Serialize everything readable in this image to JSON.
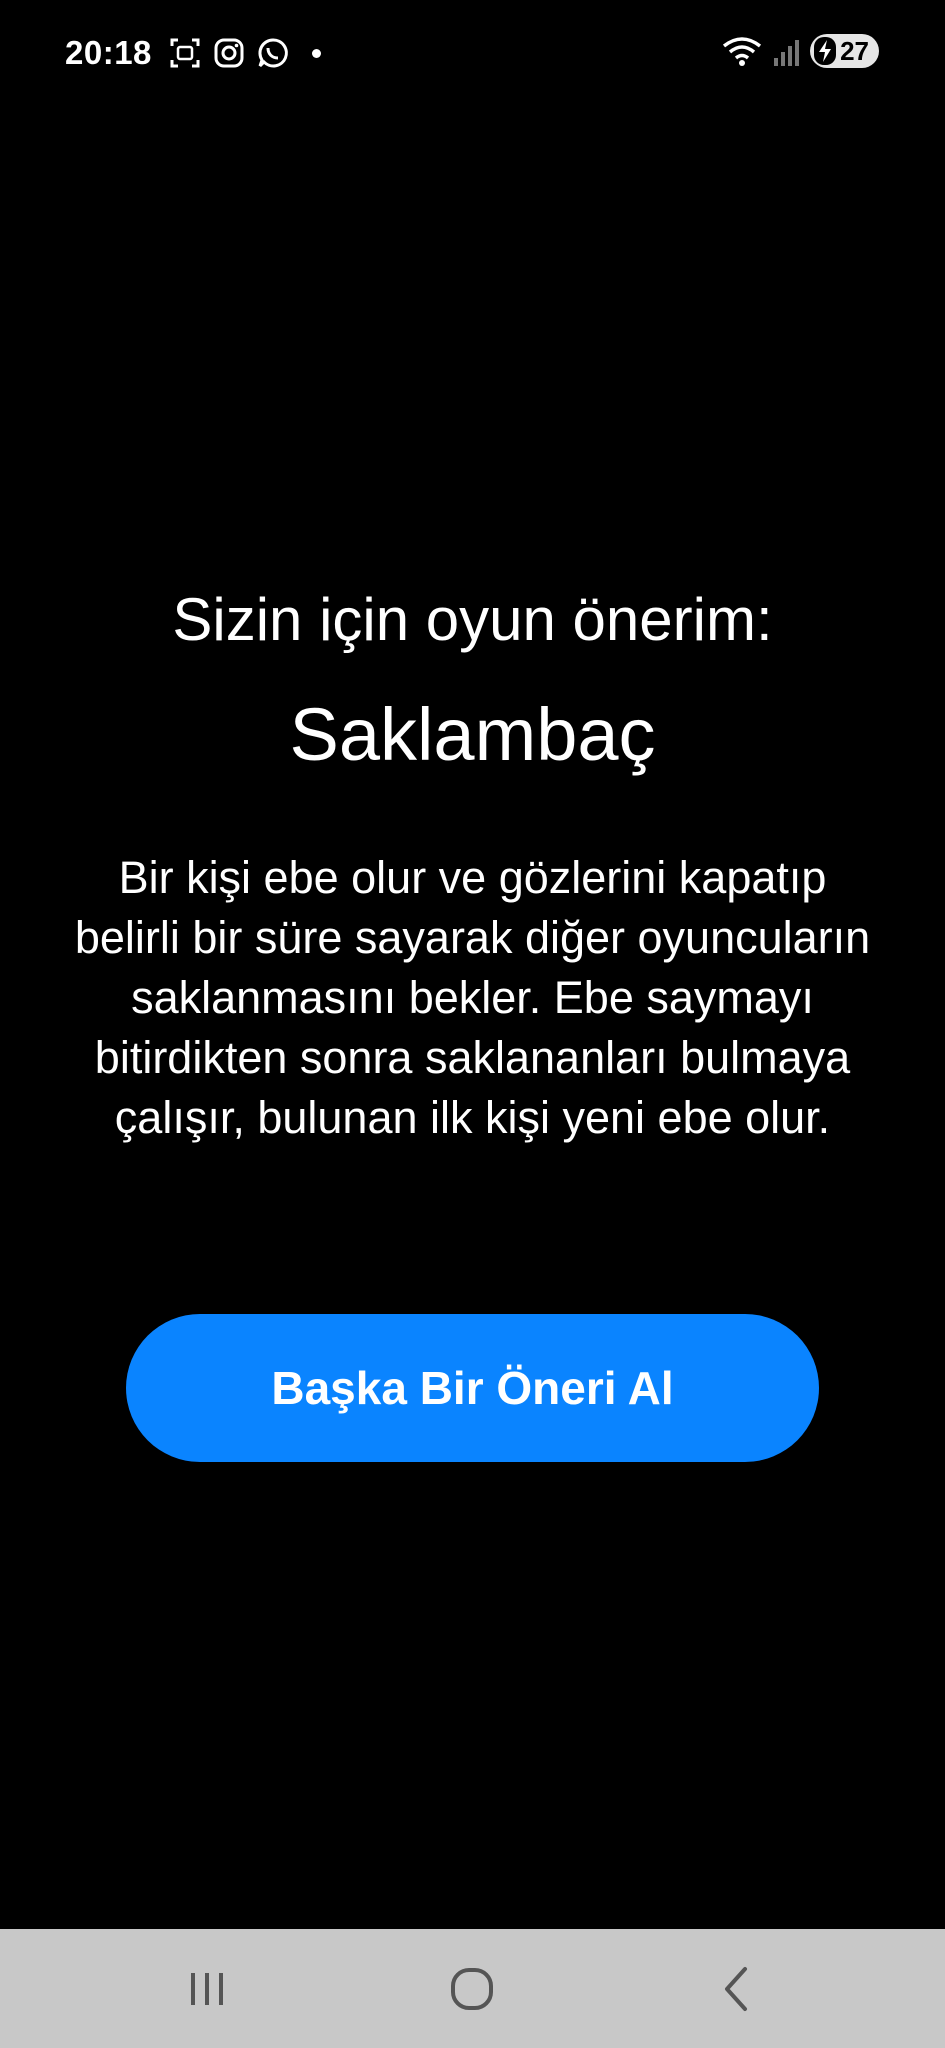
{
  "status_bar": {
    "time": "20:18",
    "notification_icons": [
      "screenshot-icon",
      "instagram-icon",
      "whatsapp-icon",
      "dot-icon"
    ],
    "system_icons": [
      "wifi-icon",
      "signal-icon",
      "battery-charging-icon"
    ],
    "battery_level": "27"
  },
  "main": {
    "heading": "Sizin için oyun önerim:",
    "game_name": "Saklambaç",
    "description": "Bir kişi ebe olur ve gözlerini kapatıp belirli bir süre sayarak diğer oyuncuların saklanmasını bekler. Ebe saymayı bitirdikten sonra saklananları bulmaya çalışır, bulunan ilk kişi yeni ebe olur.",
    "button_label": "Başka Bir Öneri Al"
  },
  "colors": {
    "background": "#000000",
    "accent": "#0a84ff",
    "nav_bar": "#c8c8c8"
  },
  "nav_bar": {
    "buttons": [
      "recents-icon",
      "home-icon",
      "back-icon"
    ]
  }
}
